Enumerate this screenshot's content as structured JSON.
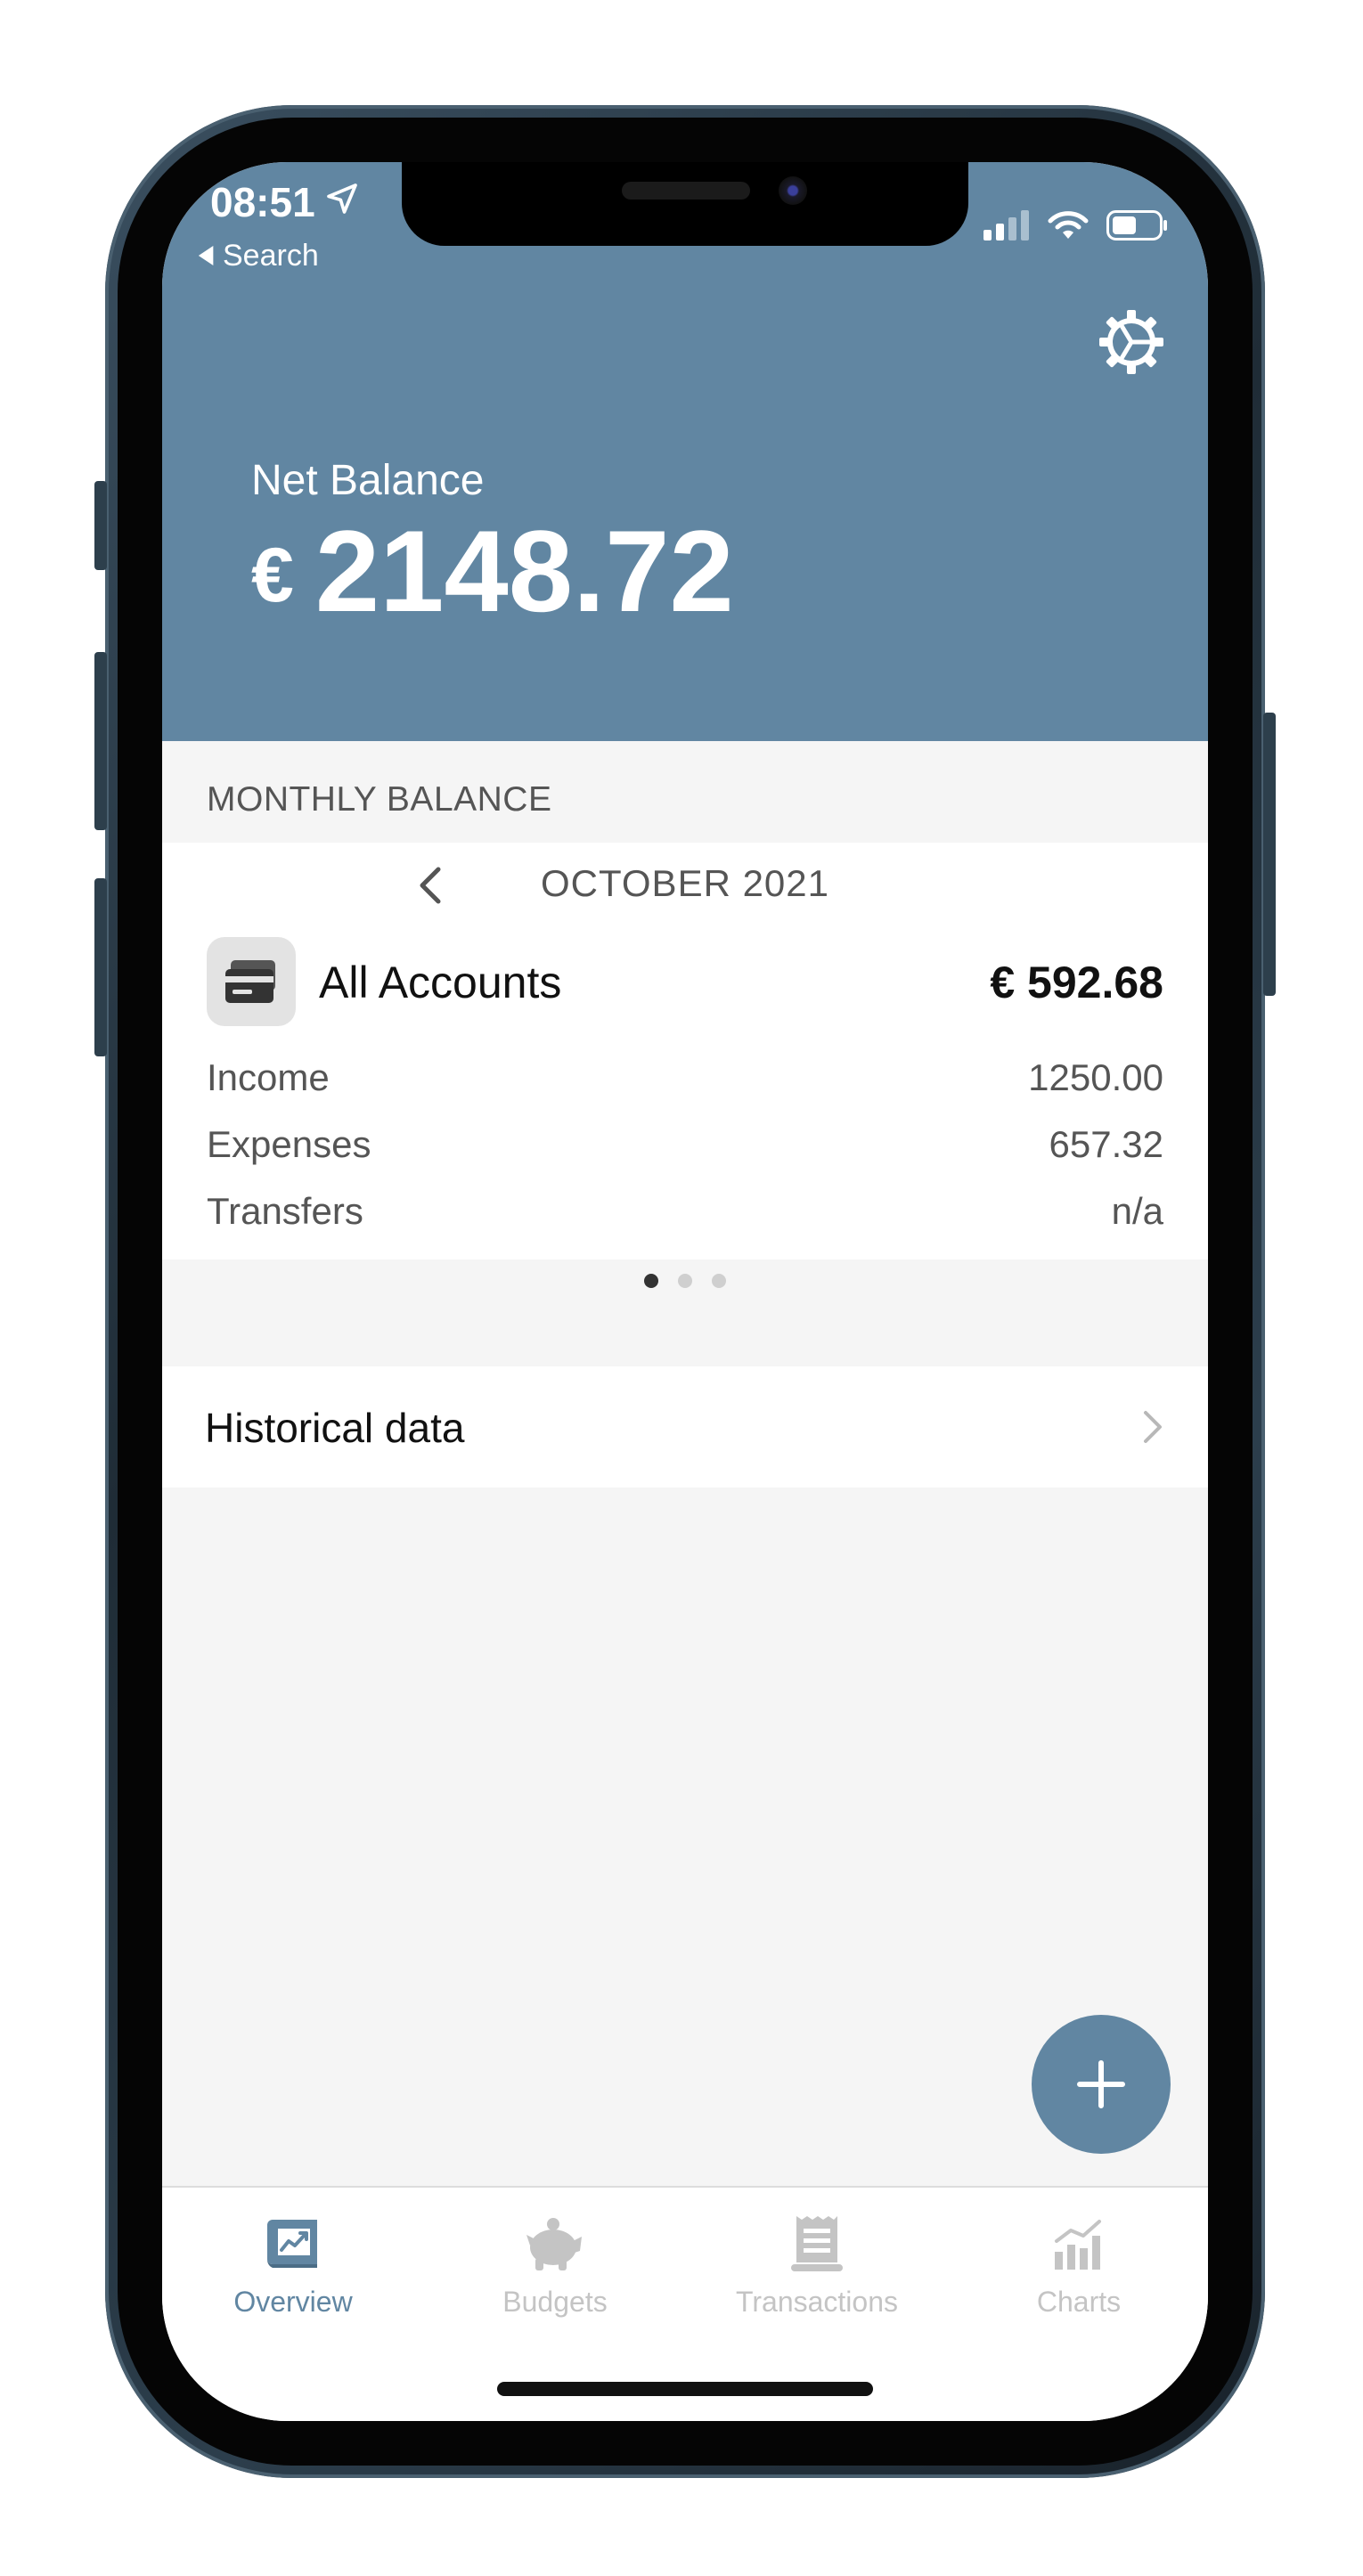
{
  "status_bar": {
    "time": "08:51",
    "back_label": "Search"
  },
  "header": {
    "net_balance_label": "Net Balance",
    "currency_symbol": "€",
    "net_balance_value": "2148.72",
    "background_color": "#6186a2"
  },
  "monthly_balance": {
    "section_title": "MONTHLY BALANCE",
    "month": "OCTOBER 2021",
    "account": {
      "name": "All Accounts",
      "amount": "€ 592.68",
      "icon": "wallet-icon"
    },
    "details": [
      {
        "label": "Income",
        "value": "1250.00"
      },
      {
        "label": "Expenses",
        "value": "657.32"
      },
      {
        "label": "Transfers",
        "value": "n/a"
      }
    ],
    "pager": {
      "total": 3,
      "active": 1
    }
  },
  "historical": {
    "label": "Historical data"
  },
  "tabs": [
    {
      "label": "Overview",
      "icon": "overview-chart-icon",
      "active": true
    },
    {
      "label": "Budgets",
      "icon": "piggy-bank-icon",
      "active": false
    },
    {
      "label": "Transactions",
      "icon": "receipt-icon",
      "active": false
    },
    {
      "label": "Charts",
      "icon": "bar-chart-icon",
      "active": false
    }
  ],
  "colors": {
    "accent": "#6186a2",
    "tab_inactive": "#c4c4c4"
  }
}
